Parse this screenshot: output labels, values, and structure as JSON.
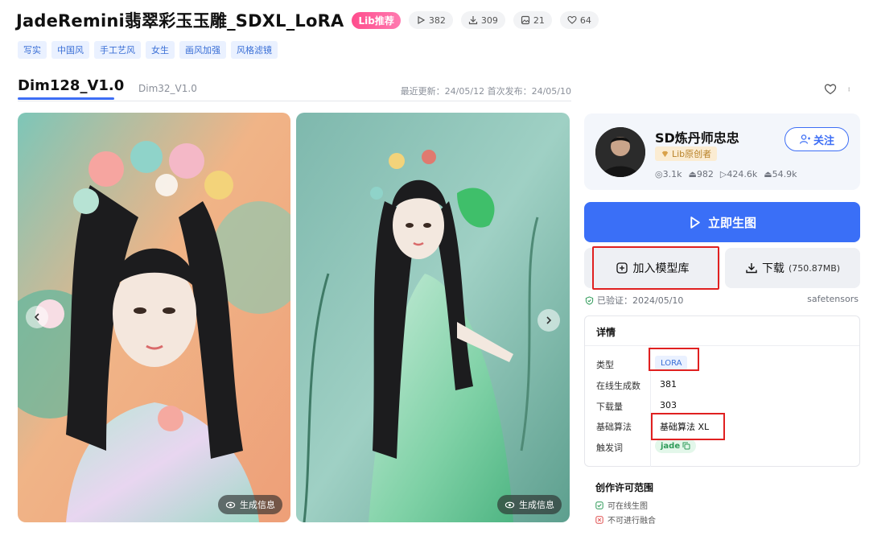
{
  "header": {
    "title": "JadeRemini翡翠彩玉玉雕_SDXL_LoRA",
    "badge": "Lib推荐",
    "stats": [
      {
        "icon": "play-icon",
        "value": "382"
      },
      {
        "icon": "download-icon",
        "value": "309"
      },
      {
        "icon": "image-icon",
        "value": "21"
      },
      {
        "icon": "heart-icon",
        "value": "64"
      }
    ]
  },
  "tags": [
    "写实",
    "中国风",
    "手工艺风",
    "女生",
    "画风加强",
    "风格滤镜"
  ],
  "versions": {
    "active": "Dim128_V1.0",
    "other": "Dim32_V1.0",
    "dates": "最近更新：24/05/12  首次发布：24/05/10"
  },
  "gallery": {
    "gen_info_label": "生成信息"
  },
  "author": {
    "name": "SD炼丹师忠忠",
    "badge": "Lib原创者",
    "follow_label": "关注",
    "stats": [
      "3.1k",
      "982",
      "424.6k",
      "54.9k"
    ]
  },
  "actions": {
    "generate_label": "立即生图",
    "add_label": "加入模型库",
    "download_label": "下载",
    "download_size": "(750.87MB)"
  },
  "verified": "已验证：2024/05/10",
  "file_format": "safetensors",
  "details": {
    "title": "详情",
    "rows": [
      {
        "label": "类型",
        "value": "LORA"
      },
      {
        "label": "在线生成数",
        "value": "381"
      },
      {
        "label": "下载量",
        "value": "303"
      },
      {
        "label": "基础算法",
        "value": "基础算法 XL"
      },
      {
        "label": "触发词",
        "value": "jade"
      }
    ]
  },
  "license": {
    "title": "创作许可范围",
    "items": [
      {
        "text": "可在线生图",
        "allowed": true
      },
      {
        "text": "不可进行融合",
        "allowed": false
      }
    ]
  },
  "colors": {
    "accent": "#3a6ff7",
    "highlight": "#e02020",
    "badge_pink": "#ff4d8d"
  }
}
